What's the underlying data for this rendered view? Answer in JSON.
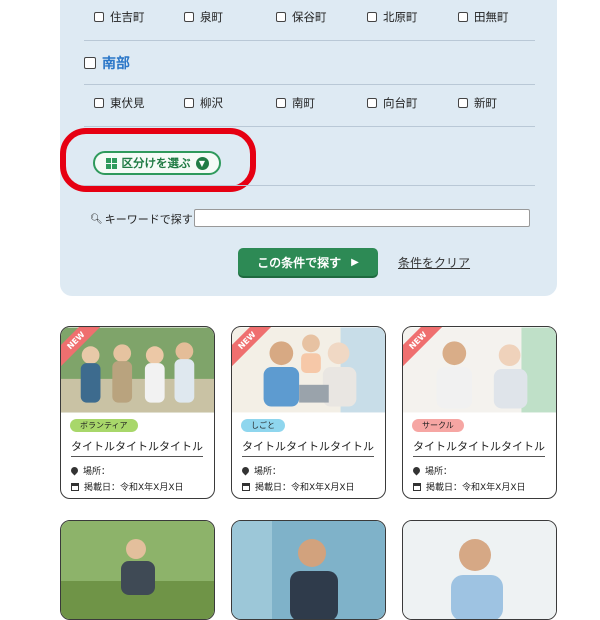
{
  "areas": {
    "row1": [
      "住吉町",
      "泉町",
      "保谷町",
      "北原町",
      "田無町"
    ],
    "south_section_label": "南部",
    "row2": [
      "東伏見",
      "柳沢",
      "南町",
      "向台町",
      "新町"
    ]
  },
  "division_button_label": "区分けを選ぶ",
  "keyword": {
    "label": "キーワードで探す",
    "value": ""
  },
  "search_button_label": "この条件で探す",
  "clear_link_label": "条件をクリア",
  "cards": [
    {
      "badge": "NEW",
      "tag": "ボランティア",
      "tag_color": "#a8d76a",
      "title": "タイトルタイトルタイトル",
      "place_label": "場所：",
      "date_label": "掲載日：令和X年X月X日"
    },
    {
      "badge": "NEW",
      "tag": "しごと",
      "tag_color": "#8fd6ee",
      "title": "タイトルタイトルタイトル",
      "place_label": "場所：",
      "date_label": "掲載日：令和X年X月X日"
    },
    {
      "badge": "NEW",
      "tag": "サークル",
      "tag_color": "#f6a6a3",
      "title": "タイトルタイトルタイトル",
      "place_label": "場所：",
      "date_label": "掲載日：令和X年X月X日"
    }
  ],
  "colors": {
    "panel": "#deeaf3",
    "accent_green": "#2d8a55",
    "section_blue": "#2a76c8",
    "highlight_red": "#e60012",
    "new_badge": "#ef6f6f"
  }
}
